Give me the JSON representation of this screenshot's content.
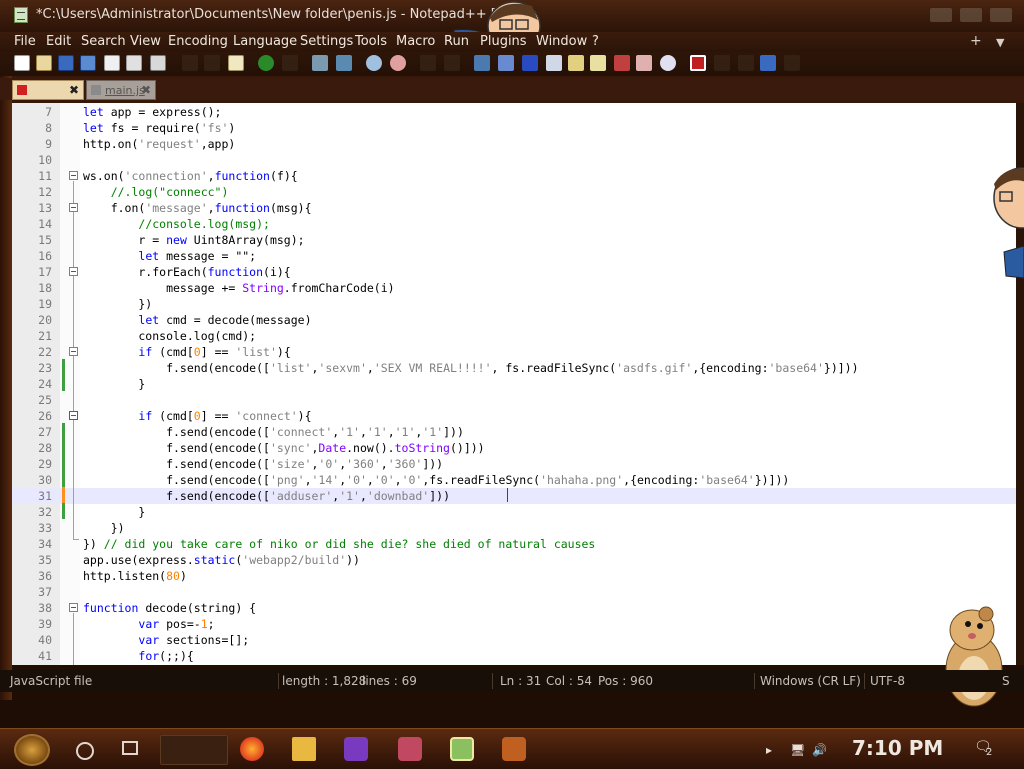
{
  "window": {
    "title": "*C:\\Users\\Administrator\\Documents\\New folder\\penis.js - Notepad++ [Admin"
  },
  "menu": [
    "File",
    "Edit",
    "Search",
    "View",
    "Encoding",
    "Language",
    "Settings",
    "Tools",
    "Macro",
    "Run",
    "Plugins",
    "Window",
    "?"
  ],
  "menu_right": [
    "+",
    "▼"
  ],
  "toolbar": {
    "icons": [
      "new-file-icon",
      "open-file-icon",
      "save-icon",
      "save-all-icon",
      "close-icon",
      "close-all-icon",
      "print-icon",
      "cut-icon",
      "copy-icon",
      "paste-icon",
      "undo-icon",
      "redo-icon",
      "find-icon",
      "replace-icon",
      "zoom-in-icon",
      "zoom-out-icon",
      "sync-vertical-icon",
      "sync-horizontal-icon",
      "wrap-icon",
      "show-all-chars-icon",
      "indent-guide-icon",
      "doc-map-icon",
      "function-list-icon",
      "folder-workspace-icon",
      "monitor-icon",
      "record-macro-icon",
      "stop-record-icon",
      "play-macro-icon",
      "run-macro-multiple-icon",
      "save-macro-icon"
    ]
  },
  "tabs": [
    {
      "label": "",
      "active": true
    },
    {
      "label": "main.js",
      "active": false
    }
  ],
  "editor": {
    "lines": [
      {
        "n": "7",
        "html": "<span class=\"kw\">let</span> app = express();"
      },
      {
        "n": "8",
        "html": "<span class=\"kw\">let</span> fs = require(<span class=\"str\">'fs'</span>)"
      },
      {
        "n": "9",
        "html": "http.on(<span class=\"str\">'request'</span>,app)"
      },
      {
        "n": "10",
        "html": ""
      },
      {
        "n": "11",
        "html": "ws.on(<span class=\"str\">'connection'</span>,<span class=\"kw\">function</span>(f){"
      },
      {
        "n": "12",
        "html": "    <span class=\"cmt\">//.log(\"connecc\")</span>"
      },
      {
        "n": "13",
        "html": "    f.on(<span class=\"str\">'message'</span>,<span class=\"kw\">function</span>(msg){"
      },
      {
        "n": "14",
        "html": "        <span class=\"cmt\">//console.log(msg);</span>"
      },
      {
        "n": "15",
        "html": "        r = <span class=\"kw\">new</span> Uint8Array(msg);"
      },
      {
        "n": "16",
        "html": "        <span class=\"kw\">let</span> message = \"\";"
      },
      {
        "n": "17",
        "html": "        r.forEach(<span class=\"kw\">function</span>(i){"
      },
      {
        "n": "18",
        "html": "            message += <span class=\"obj\">String</span>.fromCharCode(i)"
      },
      {
        "n": "19",
        "html": "        })"
      },
      {
        "n": "20",
        "html": "        <span class=\"kw\">let</span> cmd = decode(message)"
      },
      {
        "n": "21",
        "html": "        console.log(cmd);"
      },
      {
        "n": "22",
        "html": "        <span class=\"kw\">if</span> (cmd[<span class=\"num\">0</span>] == <span class=\"str\">'list'</span>){"
      },
      {
        "n": "23",
        "html": "            f.send(encode([<span class=\"str\">'list'</span>,<span class=\"str\">'sexvm'</span>,<span class=\"str\">'SEX VM REAL!!!!'</span>, fs.readFileSync(<span class=\"str\">'asdfs.gif'</span>,{encoding:<span class=\"str\">'base64'</span>})]))"
      },
      {
        "n": "24",
        "html": "        }"
      },
      {
        "n": "25",
        "html": ""
      },
      {
        "n": "26",
        "html": "        <span class=\"kw\">if</span> (cmd[<span class=\"num\">0</span>] == <span class=\"str\">'connect'</span>){"
      },
      {
        "n": "27",
        "html": "            f.send(encode([<span class=\"str\">'connect'</span>,<span class=\"str\">'1'</span>,<span class=\"str\">'1'</span>,<span class=\"str\">'1'</span>,<span class=\"str\">'1'</span>]))"
      },
      {
        "n": "28",
        "html": "            f.send(encode([<span class=\"str\">'sync'</span>,<span class=\"obj\">Date</span>.now().<span class=\"obj\">toString</span>()]))"
      },
      {
        "n": "29",
        "html": "            f.send(encode([<span class=\"str\">'size'</span>,<span class=\"str\">'0'</span>,<span class=\"str\">'360'</span>,<span class=\"str\">'360'</span>]))"
      },
      {
        "n": "30",
        "html": "            f.send(encode([<span class=\"str\">'png'</span>,<span class=\"str\">'14'</span>,<span class=\"str\">'0'</span>,<span class=\"str\">'0'</span>,<span class=\"str\">'0'</span>,fs.readFileSync(<span class=\"str\">'hahaha.png'</span>,{encoding:<span class=\"str\">'base64'</span>})]))"
      },
      {
        "n": "31",
        "html": "            f.send(encode([<span class=\"str\">'adduser'</span>,<span class=\"str\">'1'</span>,<span class=\"str\">'downbad'</span>]))"
      },
      {
        "n": "32",
        "html": "        }"
      },
      {
        "n": "33",
        "html": "    })"
      },
      {
        "n": "34",
        "html": "}) <span class=\"cmt\">// did you take care of niko or did she die? she died of natural causes</span>"
      },
      {
        "n": "35",
        "html": "app.use(express.<span class=\"kw\">static</span>(<span class=\"str\">'webapp2/build'</span>))"
      },
      {
        "n": "36",
        "html": "http.listen(<span class=\"num\">80</span>)"
      },
      {
        "n": "37",
        "html": ""
      },
      {
        "n": "38",
        "html": "<span class=\"kw\">function</span> decode(string) {"
      },
      {
        "n": "39",
        "html": "        <span class=\"kw\">var</span> pos=-<span class=\"num\">1</span>;"
      },
      {
        "n": "40",
        "html": "        <span class=\"kw\">var</span> sections=[];"
      },
      {
        "n": "41",
        "html": "        <span class=\"kw\">for</span>(;;){"
      }
    ]
  },
  "status": {
    "filetype": "JavaScript file",
    "length": "length : 1,828",
    "lines": "lines : 69",
    "ln": "Ln : 31",
    "col": "Col : 54",
    "pos": "Pos : 960",
    "eol": "Windows (CR LF)",
    "encoding": "UTF-8",
    "mode": "S"
  },
  "taskbar": {
    "time": "7:10 PM",
    "notification_count": "2",
    "apps": [
      "firefox-icon",
      "file-explorer-icon",
      "visual-studio-icon",
      "game-character-icon",
      "notepadpp-icon",
      "vu-meter-icon"
    ]
  }
}
